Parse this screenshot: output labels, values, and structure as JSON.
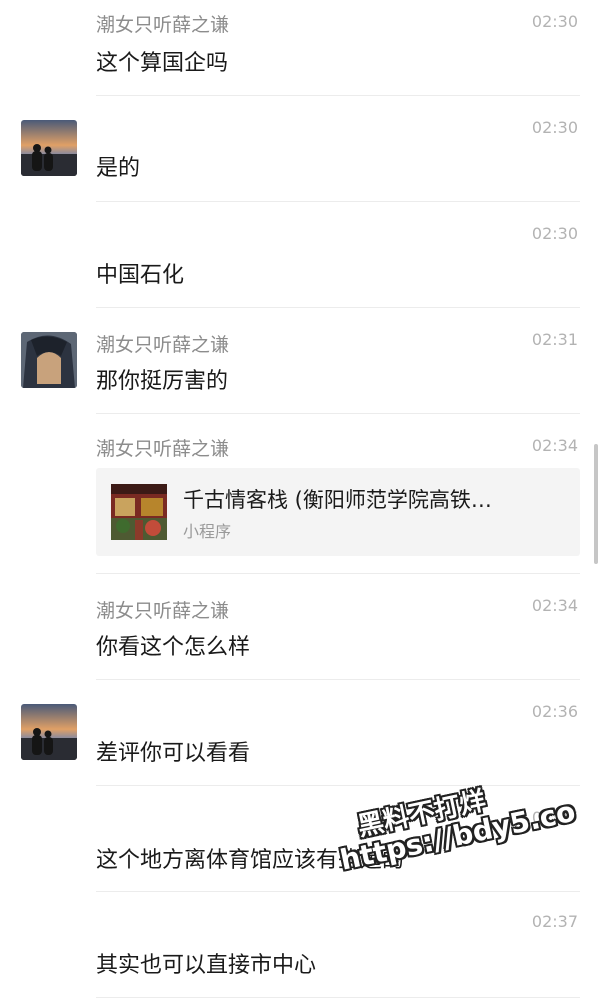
{
  "messages": [
    {
      "sender": "潮女只听薛之谦",
      "time": "02:30",
      "text": "这个算国企吗",
      "avatar": ""
    },
    {
      "sender": "",
      "time": "02:30",
      "text": "是的",
      "avatar": "sunset-couple-avatar"
    },
    {
      "sender": "",
      "time": "02:30",
      "text": "中国石化",
      "avatar": ""
    },
    {
      "sender": "潮女只听薛之谦",
      "time": "02:31",
      "text": "那你挺厉害的",
      "avatar": "hooded-girl-avatar"
    },
    {
      "sender": "潮女只听薛之谦",
      "time": "02:34",
      "card": {
        "title": "千古情客栈 (衡阳师范学院高铁…",
        "type": "小程序",
        "thumb": "inn-photo"
      }
    },
    {
      "sender": "潮女只听薛之谦",
      "time": "02:34",
      "text": "你看这个怎么样",
      "avatar": ""
    },
    {
      "sender": "",
      "time": "02:36",
      "text": "差评你可以看看",
      "avatar": "sunset-couple-avatar"
    },
    {
      "sender": "",
      "time": "02:37",
      "text": "这个地方离体育馆应该有些远的",
      "avatar": ""
    },
    {
      "sender": "",
      "time": "02:37",
      "text": "其实也可以直接市中心",
      "avatar": ""
    }
  ],
  "watermark": {
    "line1": "黑料不打烊",
    "line2": "https://bdy5.co"
  },
  "colors": {
    "background": "#ffffff",
    "card": "#f4f4f4",
    "divider": "#ececec",
    "name": "#8c8c8c",
    "time": "#b3b3b3"
  }
}
